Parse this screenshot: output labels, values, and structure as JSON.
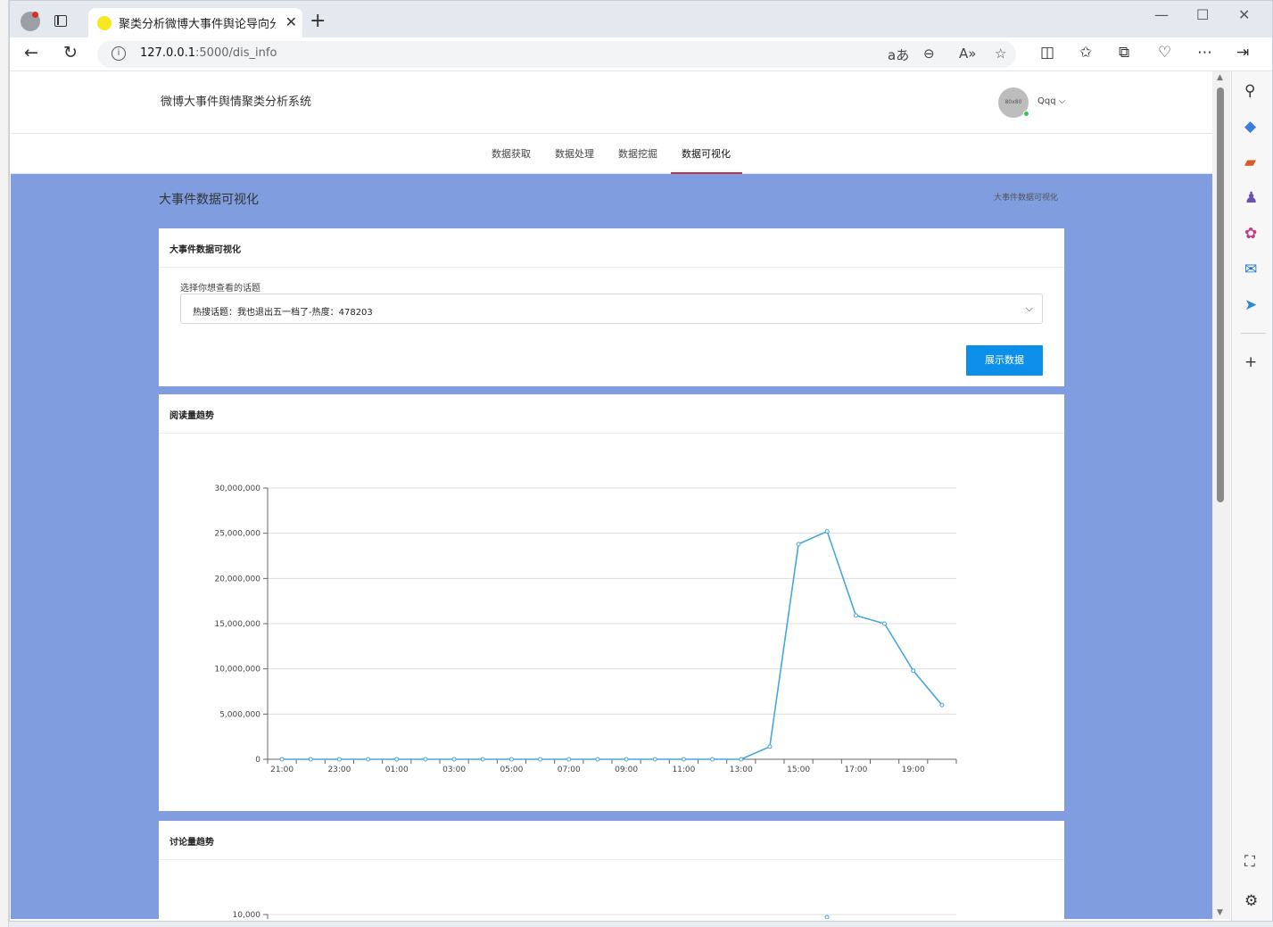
{
  "browser": {
    "tab_title": "聚类分析微博大事件舆论导向分析",
    "tab_close": "✕",
    "new_tab": "+",
    "url_host": "127.0.0.1",
    "url_path": ":5000/dis_info",
    "window_controls": {
      "minimize": "—",
      "maximize": "☐",
      "close": "✕"
    }
  },
  "site": {
    "title": "微博大事件舆情聚类分析系统",
    "avatar_placeholder": "80x80",
    "user_name": "Qqq ⌵",
    "nav": [
      "数据获取",
      "数据处理",
      "数据挖掘",
      "数据可视化"
    ],
    "active_nav": "数据可视化"
  },
  "page": {
    "heading": "大事件数据可视化",
    "breadcrumb": "大事件数据可视化"
  },
  "topic_card": {
    "title": "大事件数据可视化",
    "select_label": "选择你想查看的话题",
    "select_value": "热搜话题：我也退出五一档了-热度：478203",
    "button": "展示数据"
  },
  "chart_cards": {
    "read_title": "阅读量趋势",
    "discuss_title": "讨论量趋势"
  },
  "chart_data": [
    {
      "type": "line",
      "title": "阅读量趋势",
      "color": "#46a7dd",
      "x": [
        "21:00",
        "22:00",
        "23:00",
        "00:00",
        "01:00",
        "02:00",
        "03:00",
        "04:00",
        "05:00",
        "06:00",
        "07:00",
        "08:00",
        "09:00",
        "10:00",
        "11:00",
        "12:00",
        "13:00",
        "14:00",
        "15:00",
        "16:00",
        "17:00",
        "18:00",
        "19:00",
        "20:00"
      ],
      "xticklabels": [
        "21:00",
        "23:00",
        "01:00",
        "03:00",
        "05:00",
        "07:00",
        "09:00",
        "11:00",
        "13:00",
        "15:00",
        "17:00",
        "19:00"
      ],
      "values": [
        0,
        0,
        0,
        0,
        0,
        0,
        0,
        0,
        0,
        0,
        0,
        0,
        0,
        0,
        0,
        0,
        0,
        1400000,
        23800000,
        25200000,
        15900000,
        15000000,
        9800000,
        6000000
      ],
      "yticks": [
        0,
        5000000,
        10000000,
        15000000,
        20000000,
        25000000,
        30000000
      ],
      "yticklabels": [
        "0",
        "5,000,000",
        "10,000,000",
        "15,000,000",
        "20,000,000",
        "25,000,000",
        "30,000,000"
      ],
      "ylim": [
        0,
        30000000
      ],
      "grid": true
    },
    {
      "type": "line",
      "title": "讨论量趋势",
      "color": "#46a7dd",
      "yticklabels": [
        "10,000"
      ]
    }
  ],
  "sidebar_icons": [
    "search-icon",
    "tag-icon",
    "toolbox-icon",
    "people-icon",
    "office-icon",
    "outlook-icon",
    "send-icon",
    "add-icon",
    "screenshot-icon",
    "settings-icon"
  ]
}
